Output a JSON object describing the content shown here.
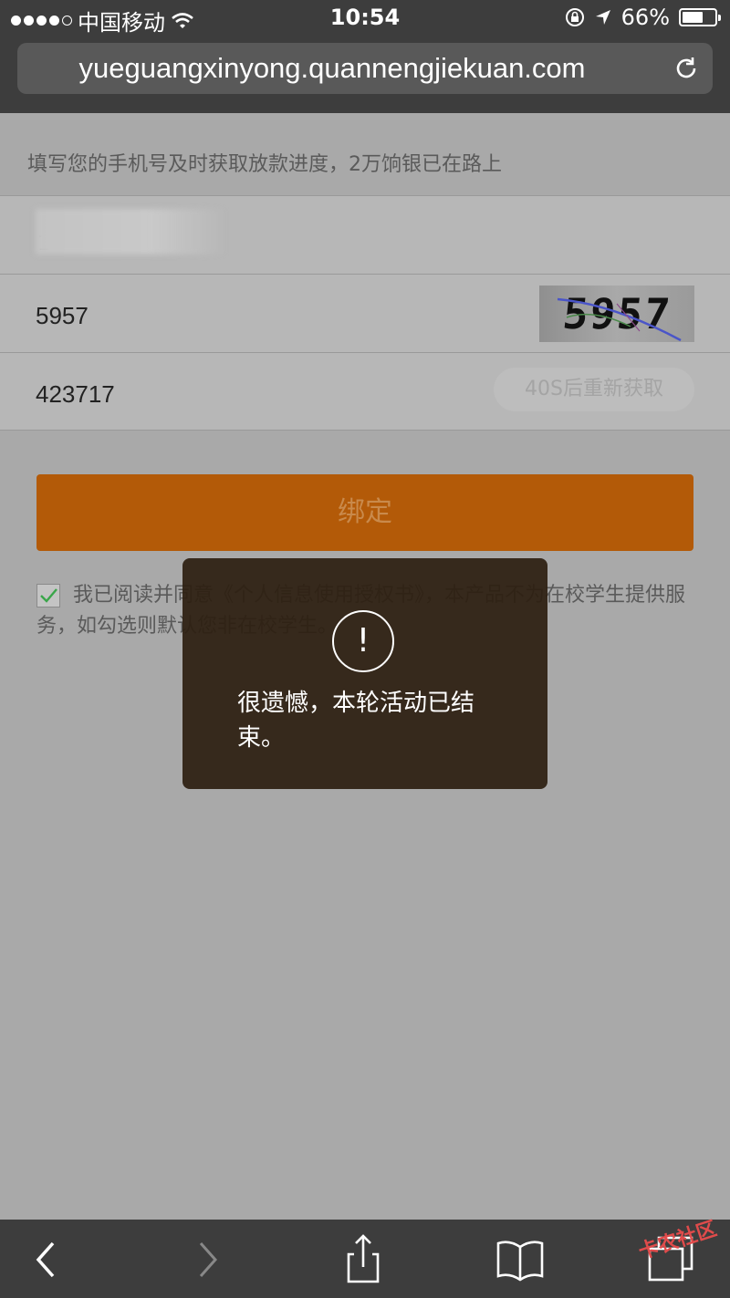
{
  "status_bar": {
    "carrier": "中国移动",
    "time": "10:54",
    "battery": "66%",
    "battery_level": 0.66
  },
  "browser": {
    "url": "yueguangxinyong.quannengjiekuan.com"
  },
  "form": {
    "notice": "填写您的手机号及时获取放款进度，2万饷银已在路上",
    "phone_value_peek": "1",
    "captcha_value": "5957",
    "captcha_image_text": "5957",
    "sms_code_value": "423717",
    "sms_button_label": "40S后重新获取",
    "confirm_label": "绑定",
    "agreement_text": "我已阅读并同意《个人信息使用授权书》，本产品不为在校学生提供服务，如勾选则默认您非在校学生。"
  },
  "toast": {
    "icon": "exclamation-icon",
    "message": "很遗憾，本轮活动已结束。"
  },
  "watermark": "卡农社区"
}
